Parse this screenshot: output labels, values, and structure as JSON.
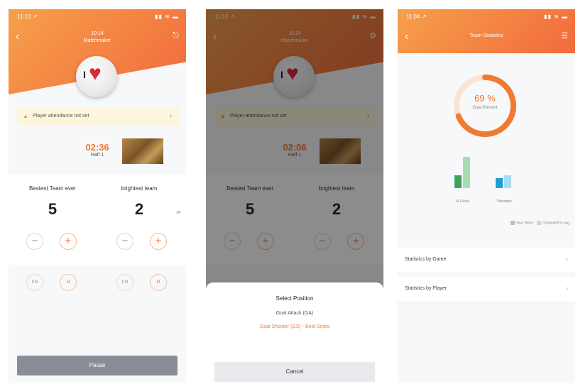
{
  "screen1": {
    "status_time": "11:10 ↗",
    "status_icons": "▮▮ ≋ ▬",
    "nav_title": "10:14",
    "nav_subtitle": "Matchmaker",
    "notice_text": "Player attendance not set",
    "timer": "02:36",
    "half": "Half 1",
    "team_left": {
      "name": "Bestest Team ever",
      "score": "5"
    },
    "team_right": {
      "name": "brightest team",
      "score": "2"
    },
    "side_glyph": "≫",
    "pm_labels": [
      "PM",
      "M",
      "PM",
      "M"
    ],
    "pause_label": "Pause"
  },
  "screen2": {
    "status_time": "11:10 ↗",
    "status_icons": "▮▮ ≋ ▬",
    "nav_title": "10:14",
    "nav_subtitle": "Matchmaker",
    "notice_text": "Player attendance not set",
    "timer": "02:06",
    "half": "Half 1",
    "team_left": {
      "name": "Bestest Team ever",
      "score": "5"
    },
    "team_right": {
      "name": "brightest team",
      "score": "2"
    },
    "sheet": {
      "title": "Select Position",
      "option_1": "Goal Attack (GA)",
      "option_2": "Goal Shooter (GS) · Best Score",
      "cancel": "Cancel"
    }
  },
  "screen3": {
    "status_time": "11:04 ↗",
    "status_icons": "▮▮ ≋ ▬",
    "nav_title": "Team Statistics",
    "ring": {
      "percent_label": "69 %",
      "label": "Goal Percent",
      "value": 0.69
    },
    "chart_data": {
      "type": "bar",
      "categories": [
        "Goals",
        "Attempts"
      ],
      "series": [
        {
          "name": "Your Team",
          "values": [
            9,
            7
          ]
        },
        {
          "name": "Compared to avg",
          "values": [
            22,
            9
          ]
        }
      ],
      "tick_labels": [
        "14 Goals",
        "7 Attempts"
      ],
      "legend": [
        "Your Team",
        "Compared to avg"
      ]
    },
    "list": [
      "Statistics by Game",
      "Statistics by Player"
    ]
  },
  "colors": {
    "accent": "#f07a34",
    "header_start": "#f6a04a",
    "header_end": "#f26a3d",
    "bar_dark_green": "#3ea35a",
    "bar_light_green": "#a8dcb5",
    "bar_dark_blue": "#1f9fd0",
    "bar_light_blue": "#a6dcf2"
  }
}
